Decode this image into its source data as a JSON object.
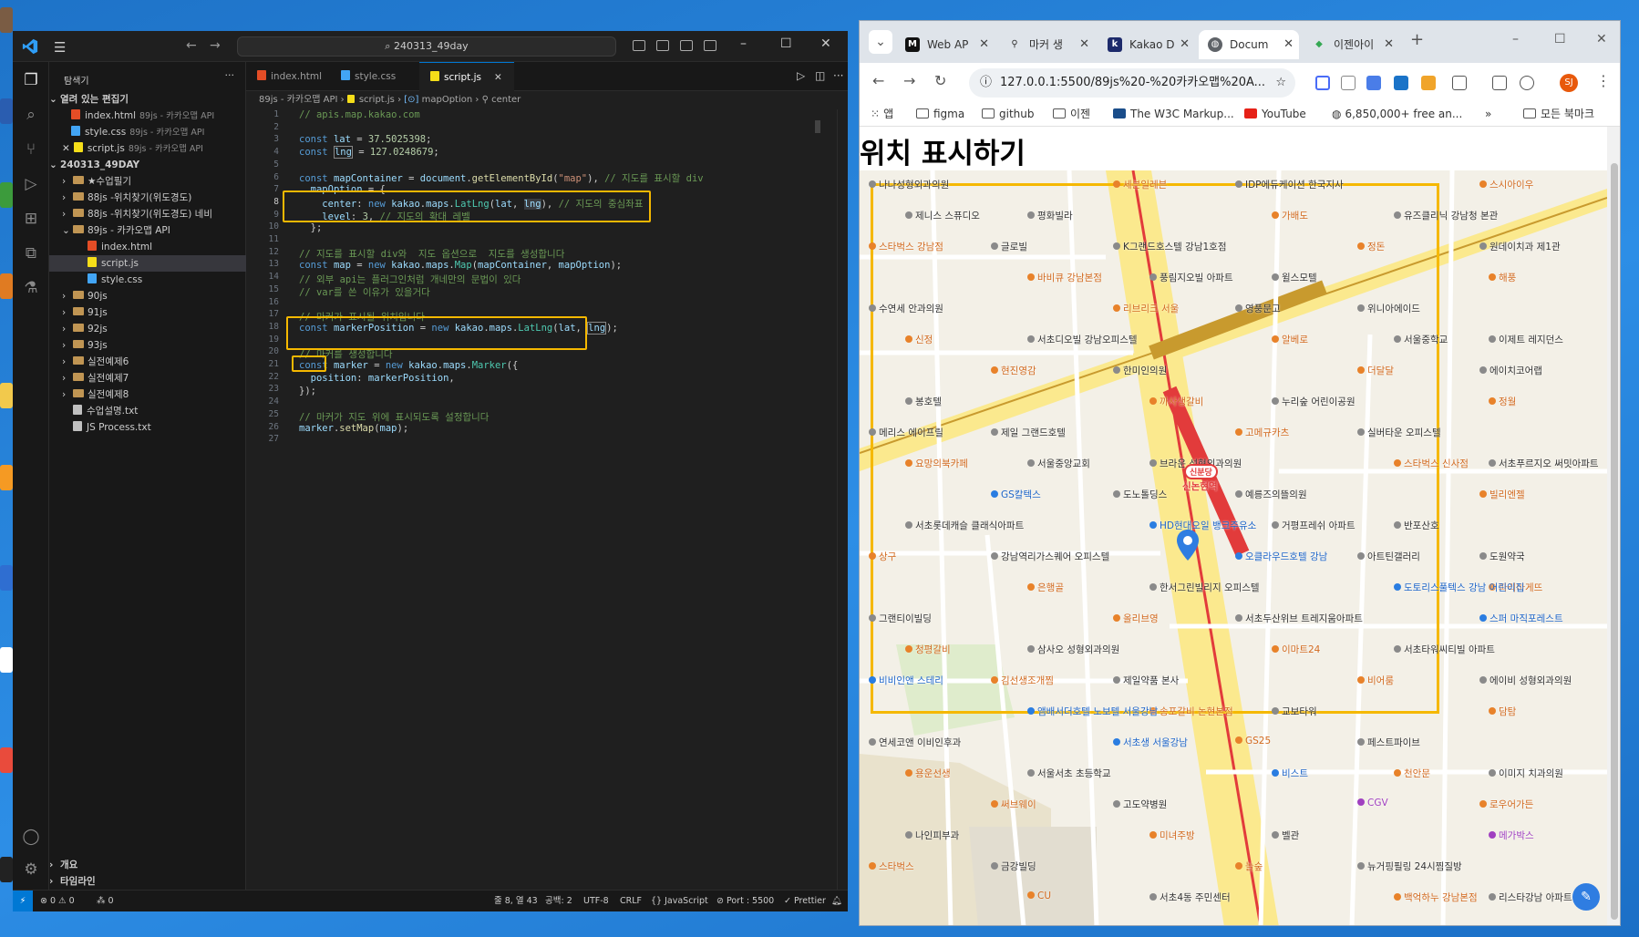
{
  "vscode": {
    "search": "240313_49day",
    "sidebar_title": "탐색기",
    "open_editors_header": "열려 있는 편집기",
    "open_editors": [
      {
        "name": "index.html",
        "sub": "89js - 카카오맵 API",
        "type": "html"
      },
      {
        "name": "style.css",
        "sub": "89js - 카카오맵 API",
        "type": "css"
      },
      {
        "name": "script.js",
        "sub": "89js - 카카오맵 API",
        "type": "js"
      }
    ],
    "workspace_header": "240313_49DAY",
    "tree": [
      {
        "label": "★수업필기",
        "kind": "folder",
        "indent": 1
      },
      {
        "label": "88js -위치찾기(위도경도)",
        "kind": "folder",
        "indent": 1
      },
      {
        "label": "88js -위치찾기(위도경도) 네비",
        "kind": "folder",
        "indent": 1
      },
      {
        "label": "89js - 카카오맵 API",
        "kind": "folder-open",
        "indent": 1
      },
      {
        "label": "index.html",
        "kind": "html",
        "indent": 2
      },
      {
        "label": "script.js",
        "kind": "js",
        "indent": 2
      },
      {
        "label": "style.css",
        "kind": "css",
        "indent": 2
      },
      {
        "label": "90js",
        "kind": "folder",
        "indent": 1
      },
      {
        "label": "91js",
        "kind": "folder",
        "indent": 1
      },
      {
        "label": "92js",
        "kind": "folder",
        "indent": 1
      },
      {
        "label": "93js",
        "kind": "folder",
        "indent": 1
      },
      {
        "label": "실전예제6",
        "kind": "folder",
        "indent": 1
      },
      {
        "label": "실전예제7",
        "kind": "folder",
        "indent": 1
      },
      {
        "label": "실전예제8",
        "kind": "folder",
        "indent": 1
      },
      {
        "label": "수업설명.txt",
        "kind": "txt",
        "indent": 1
      },
      {
        "label": "JS Process.txt",
        "kind": "txt",
        "indent": 1
      }
    ],
    "outline_label": "개요",
    "timeline_label": "타임라인",
    "tabs": [
      "index.html",
      "style.css",
      "script.js"
    ],
    "breadcrumb": [
      "89js - 카카오맵 API",
      "script.js",
      "mapOption",
      "center"
    ],
    "code_lines": [
      "1",
      "2",
      "3",
      "4",
      "5",
      "6",
      "7",
      "8",
      "9",
      "10",
      "11",
      "12",
      "13",
      "14",
      "15",
      "16",
      "17",
      "18",
      "19",
      "20",
      "21",
      "22",
      "23",
      "24",
      "25",
      "26",
      "27"
    ],
    "status": {
      "errors": "⊗ 0 ⚠ 0",
      "ports": "⁂ 0",
      "position": "줄 8, 열 43",
      "spaces": "공백: 2",
      "encoding": "UTF-8",
      "eol": "CRLF",
      "language": "{} JavaScript",
      "port": "⊘ Port : 5500",
      "prettier": "✓ Prettier"
    }
  },
  "chrome": {
    "tabs": [
      {
        "label": "Web AP",
        "fav": "M"
      },
      {
        "label": "마커 생",
        "fav": "pin"
      },
      {
        "label": "Kakao D",
        "fav": "k"
      },
      {
        "label": "Docum",
        "fav": "globe"
      },
      {
        "label": "이젠아이",
        "fav": "maps"
      }
    ],
    "url": "127.0.0.1:5500/89js%20-%20카카오맵%20A...",
    "bookmarks": [
      "앱",
      "figma",
      "github",
      "이젠",
      "The W3C Markup...",
      "YouTube",
      "6,850,000+ free an...",
      "모든 북마크"
    ],
    "profile_initial": "SJ",
    "page_title": "위치 표시하기",
    "map_labels": {
      "black": [
        "나나성형외과의원",
        "평화빌라",
        "K그랜드호스텔 강남1호점",
        "윌스모텔",
        "위니아에이드",
        "이제트 레지던스",
        "봉호텔",
        "제일 그랜드호텔",
        "브라운 성형외과의원",
        "예릉즈의뜰의원",
        "반포산호",
        "도원약국",
        "그랜티이빌딩",
        "삼사오 성형외과의원",
        "제일약품 본사",
        "교보타워",
        "페스트파이브",
        "이미지 치과의원",
        "나인피부과",
        "금강빌딩",
        "서초4동 주민센터",
        "IDP에듀케이션 한국지사",
        "유즈클리닉 강남청 본관",
        "원데이치과 제1관",
        "수연세 안과의원",
        "서초디오빌 강남오피스텔",
        "한미인의원",
        "누리숲 어린이공원",
        "실버타운 오피스텔",
        "서초푸르지오 써밋아파트",
        "서초롯데캐슬 클래식아파트",
        "강남역리가스퀘어 오피스텔",
        "한서그린빌리지 오피스텔",
        "서초두산위브 트레지움아파트",
        "서초타워씨티빌 아파트",
        "에이비 성형외과의원",
        "연세코앤 이비인후과",
        "서울서초 초등학교",
        "고도약병원",
        "벨관",
        "뉴거핑필링 24시찜질방",
        "리스타강남 아파트",
        "제니스 스퓨디오",
        "글로빌",
        "풍림지오빌 아파트",
        "영풍문고",
        "서울중학교",
        "에이치코어랩",
        "메리스 에이프릴",
        "서울중앙교회",
        "도노톨딩스",
        "거평프레쉬 아파트",
        "아트틴갤러리"
      ],
      "orange": [
        "파리바게뜨",
        "청평갈비",
        "김선생조개찜",
        "송포갈비 논현본점",
        "GS25",
        "천안문",
        "로우어가든",
        "스타벅스",
        "CU",
        "세븐일레븐",
        "가배도",
        "정돈",
        "해풍",
        "신정",
        "현진영감",
        "까사생갈비",
        "고메규카츠",
        "스타벅스 신사점",
        "빌리엔젤",
        "상구",
        "은행골",
        "올리브영",
        "이마트24",
        "비어룸",
        "담탐",
        "용운선생",
        "써브웨이",
        "미녀주방",
        "놀숲",
        "백억하누 강남본점",
        "스시아이우",
        "스타벅스 강남점",
        "바비큐 강남본점",
        "리브리크 서울",
        "알베로",
        "더달달",
        "정월",
        "요망의북카페"
      ],
      "blue": [
        "GS칼텍스",
        "HD현대오일 뱅크주유소",
        "오클라우드호텔 강남",
        "도토리스풀텍스 강남 어린이집",
        "스퍼 마직포레스트",
        "비비인앤 스테리",
        "앰배서더호텔 노보텔 서울강남",
        "서초생 서울강남",
        "비스트"
      ],
      "purple": [
        "CGV",
        "메가박스"
      ],
      "station": "신논현역",
      "line_badge": "신분당"
    }
  },
  "colors": {
    "vs_bg": "#1f1f1f",
    "highlight_box": "#f5b800",
    "map_road_yellow": "#f7e68a",
    "map_line_red": "#e23b3b",
    "map_line_gold": "#c89a2e"
  }
}
